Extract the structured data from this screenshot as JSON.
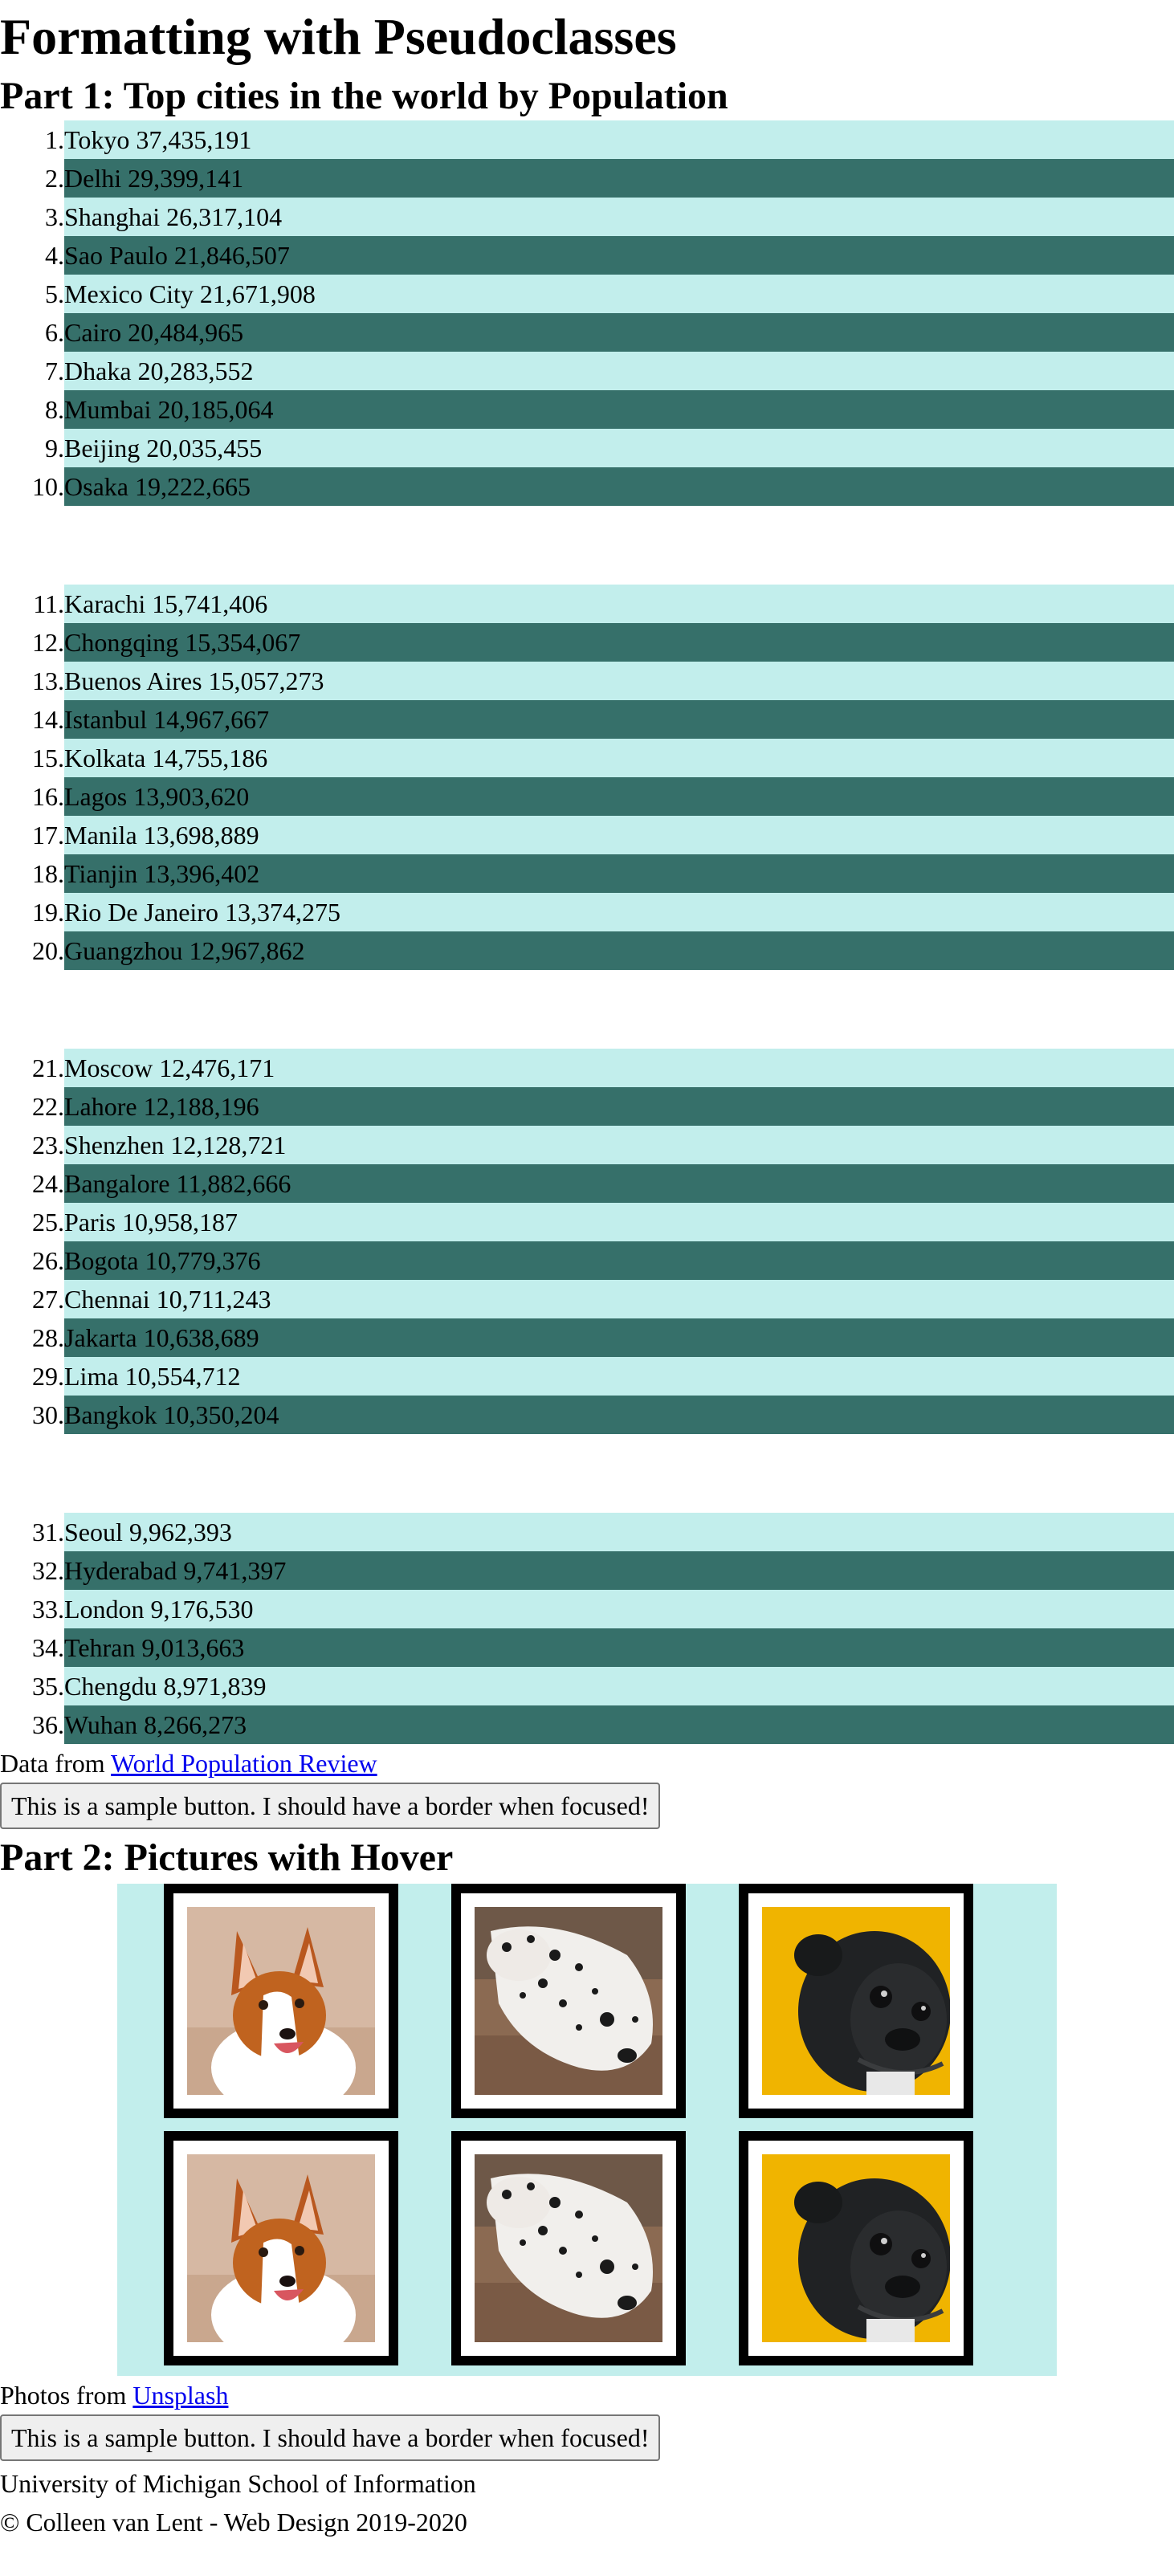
{
  "page": {
    "title": "Formatting with Pseudoclasses",
    "part1_title": "Part 1: Top cities in the world by Population",
    "part2_title": "Part 2: Pictures with Hover"
  },
  "cities": [
    [
      {
        "num": "1.",
        "label": "Tokyo 37,435,191"
      },
      {
        "num": "2.",
        "label": "Delhi 29,399,141"
      },
      {
        "num": "3.",
        "label": "Shanghai 26,317,104"
      },
      {
        "num": "4.",
        "label": "Sao Paulo 21,846,507"
      },
      {
        "num": "5.",
        "label": "Mexico City 21,671,908"
      },
      {
        "num": "6.",
        "label": "Cairo 20,484,965"
      },
      {
        "num": "7.",
        "label": "Dhaka 20,283,552"
      },
      {
        "num": "8.",
        "label": "Mumbai 20,185,064"
      },
      {
        "num": "9.",
        "label": "Beijing 20,035,455"
      },
      {
        "num": "10.",
        "label": "Osaka 19,222,665"
      }
    ],
    [
      {
        "num": "11.",
        "label": "Karachi 15,741,406"
      },
      {
        "num": "12.",
        "label": "Chongqing 15,354,067"
      },
      {
        "num": "13.",
        "label": "Buenos Aires 15,057,273"
      },
      {
        "num": "14.",
        "label": "Istanbul 14,967,667"
      },
      {
        "num": "15.",
        "label": "Kolkata 14,755,186"
      },
      {
        "num": "16.",
        "label": "Lagos 13,903,620"
      },
      {
        "num": "17.",
        "label": "Manila 13,698,889"
      },
      {
        "num": "18.",
        "label": "Tianjin 13,396,402"
      },
      {
        "num": "19.",
        "label": "Rio De Janeiro 13,374,275"
      },
      {
        "num": "20.",
        "label": "Guangzhou 12,967,862"
      }
    ],
    [
      {
        "num": "21.",
        "label": "Moscow 12,476,171"
      },
      {
        "num": "22.",
        "label": "Lahore 12,188,196"
      },
      {
        "num": "23.",
        "label": "Shenzhen 12,128,721"
      },
      {
        "num": "24.",
        "label": "Bangalore 11,882,666"
      },
      {
        "num": "25.",
        "label": "Paris 10,958,187"
      },
      {
        "num": "26.",
        "label": "Bogota 10,779,376"
      },
      {
        "num": "27.",
        "label": "Chennai 10,711,243"
      },
      {
        "num": "28.",
        "label": "Jakarta 10,638,689"
      },
      {
        "num": "29.",
        "label": "Lima 10,554,712"
      },
      {
        "num": "30.",
        "label": "Bangkok 10,350,204"
      }
    ],
    [
      {
        "num": "31.",
        "label": "Seoul 9,962,393"
      },
      {
        "num": "32.",
        "label": "Hyderabad 9,741,397"
      },
      {
        "num": "33.",
        "label": "London 9,176,530"
      },
      {
        "num": "34.",
        "label": "Tehran 9,013,663"
      },
      {
        "num": "35.",
        "label": "Chengdu 8,971,839"
      },
      {
        "num": "36.",
        "label": "Wuhan 8,266,273"
      }
    ]
  ],
  "part1": {
    "source_prefix": "Data from ",
    "source_link": "World Population Review",
    "button_label": "This is a sample button. I should have a border when focused!"
  },
  "part2": {
    "photos": [
      {
        "subject": "corgi"
      },
      {
        "subject": "dalmatian"
      },
      {
        "subject": "pug"
      },
      {
        "subject": "corgi"
      },
      {
        "subject": "dalmatian"
      },
      {
        "subject": "pug"
      }
    ],
    "source_prefix": "Photos from ",
    "source_link": "Unsplash",
    "button_label": "This is a sample button. I should have a border when focused!"
  },
  "footer": {
    "line1": "University of Michigan School of Information",
    "line2": "© Colleen van Lent - Web Design 2019-2020"
  },
  "colors": {
    "row_light": "#c2eeec",
    "row_dark": "#36706a",
    "gallery_bg": "#c2eeec",
    "link": "#0000ee"
  }
}
